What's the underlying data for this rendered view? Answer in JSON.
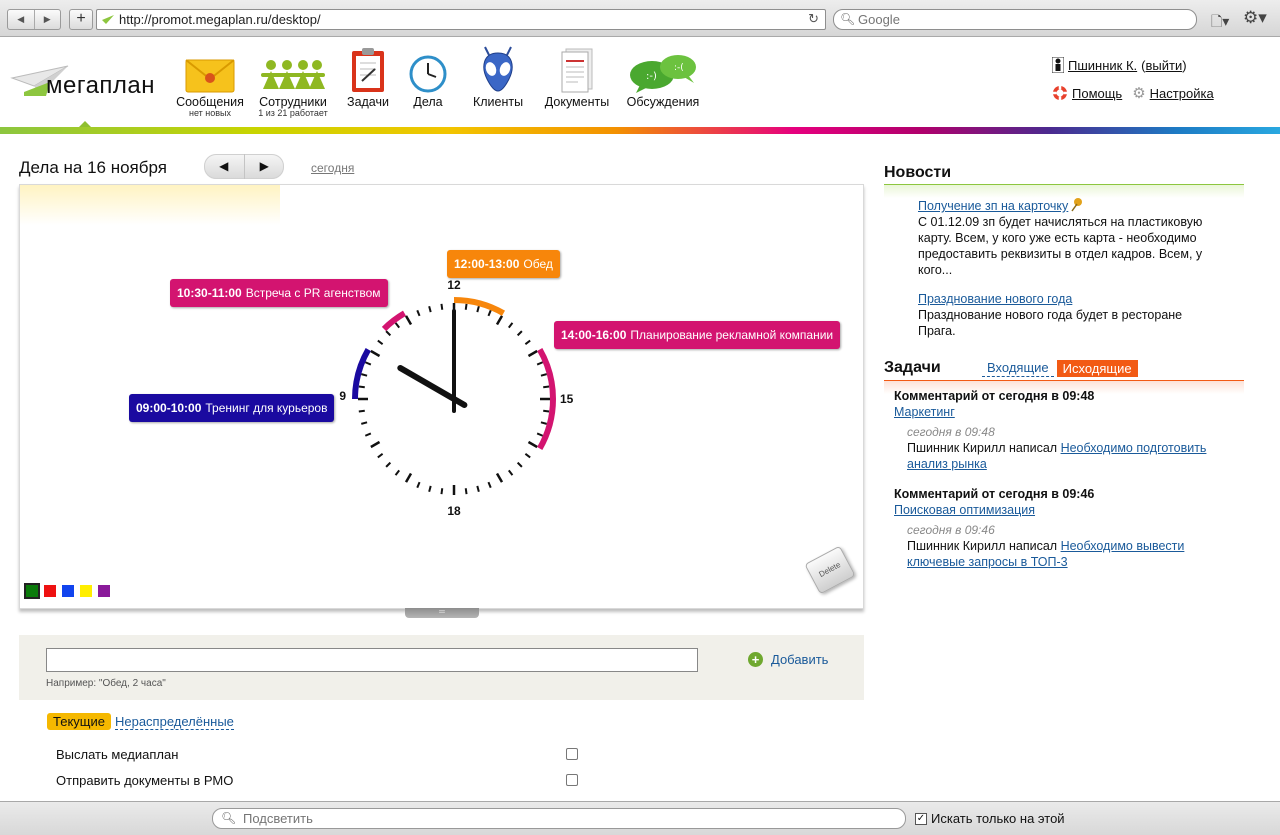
{
  "browser": {
    "url": "http://promot.megaplan.ru/desktop/",
    "search_placeholder": "Google",
    "back_label": "◀",
    "forward_label": "▶",
    "new_tab_label": "+",
    "reload_label": "↻"
  },
  "header": {
    "logo_text": "мегаплан",
    "nav": [
      {
        "label": "Сообщения",
        "sub": "нет новых",
        "icon": "envelope-icon"
      },
      {
        "label": "Сотрудники",
        "sub": "1 из 21 работает",
        "icon": "people-icon"
      },
      {
        "label": "Задачи",
        "icon": "clipboard-icon"
      },
      {
        "label": "Дела",
        "icon": "clock-icon"
      },
      {
        "label": "Клиенты",
        "icon": "alien-icon"
      },
      {
        "label": "Документы",
        "icon": "document-icon"
      },
      {
        "label": "Обсуждения",
        "icon": "speech-bubbles-icon"
      }
    ],
    "user": {
      "name": "Пшинник К.",
      "logout_open": "(",
      "logout": "выйти",
      "logout_close": ")",
      "help": "Помощь",
      "settings": "Настройка"
    }
  },
  "day": {
    "title": "Дела на 16 ноября",
    "prev_label": "◀",
    "next_label": "▶",
    "today_link": "сегодня"
  },
  "clock": {
    "hour_labels": {
      "top": "12",
      "right": "15",
      "bottom": "18",
      "left": "9"
    },
    "hands": {
      "hour": 10,
      "minute": 0
    },
    "events": [
      {
        "time": "12:00-13:00",
        "title": "Обед",
        "start": 12,
        "end": 13,
        "color": "#f7860b"
      },
      {
        "time": "10:30-11:00",
        "title": "Встреча с PR агенством",
        "start": 10.5,
        "end": 11,
        "color": "#d31470"
      },
      {
        "time": "14:00-16:00",
        "title": "Планирование рекламной компании",
        "start": 14,
        "end": 16,
        "color": "#d31470"
      },
      {
        "time": "09:00-10:00",
        "title": "Тренинг для курьеров",
        "start": 9,
        "end": 10,
        "color": "#1a0aa0"
      }
    ],
    "swatches": [
      "#0a7a0a",
      "#ee1111",
      "#1144ee",
      "#ffee00",
      "#8a1a9a"
    ],
    "delete_label": "Delete",
    "handle_label": "═"
  },
  "add_task": {
    "input_value": "",
    "hint": "Например: \"Обед, 2 часа\"",
    "button_label": "Добавить"
  },
  "list_tabs": {
    "current": "Текущие",
    "unassigned": "Нераспределённые"
  },
  "todos": [
    {
      "label": "Выслать медиаплан",
      "checked": false
    },
    {
      "label": "Отправить документы в РМО",
      "checked": false
    }
  ],
  "news": {
    "title": "Новости",
    "items": [
      {
        "title": "Получение зп на карточку",
        "body": "С 01.12.09 зп будет начисляться на пластиковую карту. Всем, у кого уже есть карта - необходимо предоставить реквизиты в отдел кадров. Всем, у кого..."
      },
      {
        "title": "Празднование нового года",
        "body": "Празднование нового года будет в ресторане Прага."
      }
    ]
  },
  "tasks": {
    "title": "Задачи",
    "tab_incoming": "Входящие",
    "tab_outgoing": "Исходящие",
    "comments": [
      {
        "title": "Комментарий от сегодня в 09:48",
        "task": "Маркетинг",
        "date": "сегодня в 09:48",
        "author": "Пшинник Кирилл написал",
        "text": "Необходимо подготовить анализ рынка"
      },
      {
        "title": "Комментарий от сегодня в 09:46",
        "task": "Поисковая оптимизация",
        "date": "сегодня в 09:46",
        "author": "Пшинник Кирилл написал",
        "text": "Необходимо вывести ключевые запросы в ТОП-3"
      }
    ]
  },
  "findbar": {
    "placeholder": "Подсветить",
    "checkbox_label": "Искать только на этой",
    "checkbox_checked": true
  }
}
